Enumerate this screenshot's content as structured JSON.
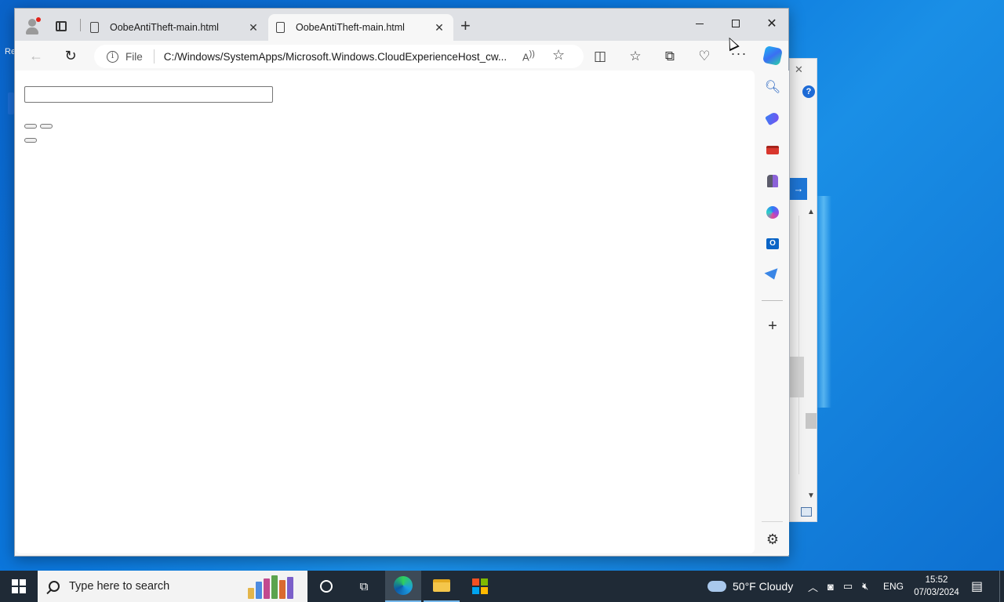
{
  "desktop": {
    "icon_label": "Re"
  },
  "browser": {
    "tabs": [
      {
        "title": "OobeAntiTheft-main.html",
        "close": "✕"
      },
      {
        "title": "OobeAntiTheft-main.html",
        "close": "✕"
      }
    ],
    "new_tab": "+",
    "window_controls": {
      "minimize": "",
      "maximize": "",
      "close": "✕"
    },
    "address": {
      "scheme_label": "File",
      "url": "C:/Windows/SystemApps/Microsoft.Windows.CloudExperienceHost_cw..."
    },
    "content": {
      "text_input_value": ""
    }
  },
  "taskbar": {
    "search_placeholder": "Type here to search",
    "weather": {
      "temp": "50°F",
      "condition": "Cloudy"
    },
    "language": "ENG",
    "time": "15:52",
    "date": "07/03/2024"
  },
  "icons": {
    "profile": "profile-icon",
    "tab_actions": "tab-actions-icon",
    "page": "page-icon",
    "back": "back-arrow-icon",
    "refresh": "refresh-icon",
    "info": "info-icon",
    "read_aloud": "read-aloud-icon",
    "favorite": "star-icon",
    "split_screen": "split-screen-icon",
    "favorites": "favorites-icon",
    "collections": "collections-icon",
    "performance": "heart-pulse-icon",
    "more": "more-icon",
    "copilot": "copilot-icon",
    "sidebar": [
      "search-icon",
      "shopping-tag-icon",
      "tools-icon",
      "games-icon",
      "microsoft365-icon",
      "outlook-icon",
      "drop-icon",
      "add-icon",
      "gear-icon"
    ]
  },
  "colors": {
    "accent": "#0a64c6",
    "desktop": "#0b78dd",
    "taskbar": "#1f2a36"
  }
}
